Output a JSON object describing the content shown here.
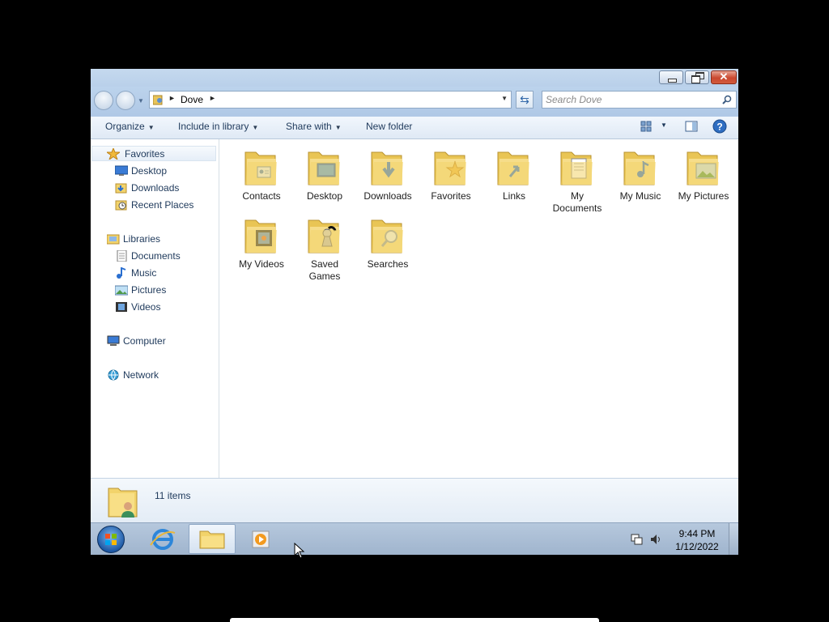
{
  "window": {
    "minimize_label": "",
    "close_glyph": "✕"
  },
  "navbar": {
    "breadcrumb": "Dove",
    "search_placeholder": "Search Dove"
  },
  "commands": {
    "organize": "Organize",
    "include_in_library": "Include in library",
    "share_with": "Share with",
    "new_folder": "New folder"
  },
  "sidebar": {
    "favorites": "Favorites",
    "favorites_items": [
      {
        "label": "Desktop",
        "icon": "desktop-icon"
      },
      {
        "label": "Downloads",
        "icon": "downloads-icon"
      },
      {
        "label": "Recent Places",
        "icon": "recent-places-icon"
      }
    ],
    "libraries": "Libraries",
    "libraries_items": [
      {
        "label": "Documents",
        "icon": "documents-icon"
      },
      {
        "label": "Music",
        "icon": "music-icon"
      },
      {
        "label": "Pictures",
        "icon": "pictures-icon"
      },
      {
        "label": "Videos",
        "icon": "videos-icon"
      }
    ],
    "computer": "Computer",
    "network": "Network"
  },
  "folders": [
    {
      "label": "Contacts",
      "overlay": "contacts"
    },
    {
      "label": "Desktop",
      "overlay": "desktop"
    },
    {
      "label": "Downloads",
      "overlay": "downloads"
    },
    {
      "label": "Favorites",
      "overlay": "favorites"
    },
    {
      "label": "Links",
      "overlay": "links"
    },
    {
      "label": "My Documents",
      "overlay": "documents"
    },
    {
      "label": "My Music",
      "overlay": "music"
    },
    {
      "label": "My Pictures",
      "overlay": "pictures"
    },
    {
      "label": "My Videos",
      "overlay": "videos"
    },
    {
      "label": "Saved Games",
      "overlay": "games"
    },
    {
      "label": "Searches",
      "overlay": "searches"
    }
  ],
  "details": {
    "item_count": "11 items"
  },
  "taskbar": {
    "time": "9:44 PM",
    "date": "1/12/2022"
  },
  "colors": {
    "accent": "#1e395b",
    "folder": "#f2d36b",
    "taskbar": "#a9bdd5"
  }
}
